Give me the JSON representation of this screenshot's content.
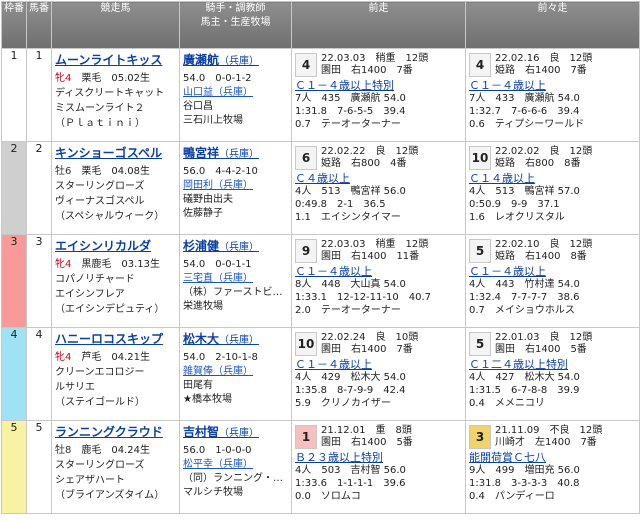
{
  "header": {
    "waku": "枠番",
    "umaban": "馬番",
    "horse": "競走馬",
    "jockey_l1": "騎手・調教師",
    "jockey_l2": "馬主・生産牧場",
    "prev1": "前走",
    "prev2": "前々走"
  },
  "colors": {
    "waku1": "#ffffff",
    "waku2": "#cfcfcf",
    "waku3": "#f99a9a",
    "waku4": "#9fe2f4",
    "waku5": "#f7f3a3",
    "link": "#0b3fa8",
    "filly": "#d6001c"
  },
  "rows": [
    {
      "waku": "1",
      "umaban": "1",
      "horse": {
        "name": "ムーンライトキッス",
        "sex": "牝4",
        "filly": true,
        "coat": "栗毛",
        "birth": "05.02生",
        "sire": "ディスクリートキャット",
        "dam": "ミスムーンライト２",
        "damsire": "（Ｐｌａｔｉｎｉ）"
      },
      "jockey": {
        "name": "廣瀬航",
        "loc": "（兵庫）",
        "wline": "54.0　0-0-1-2",
        "trainer": "山口益（兵庫）",
        "owner": "谷口昌",
        "breeder": "三石川上牧場"
      },
      "prev1": {
        "rank": "4",
        "l1": "22.03.03　稍重　12頭",
        "l2": "園田　右1400　7番",
        "title": "Ｃ１－４歳以上特別",
        "l3": "7人　435　廣瀬航 54.0",
        "l4": "1:31.8　7-6-5-5　39.4",
        "l5": "0.7　テーオーターナー"
      },
      "prev2": {
        "rank": "4",
        "l1": "22.02.16　良　12頭",
        "l2": "姫路　右1400　7番",
        "title": "Ｃ１－４歳以上",
        "l3": "7人　433　廣瀬航 54.0",
        "l4": "1:32.7　7-6-6-6　39.4",
        "l5": "0.6　ティプシーワールド"
      }
    },
    {
      "waku": "2",
      "umaban": "2",
      "horse": {
        "name": "キンショーゴスペル",
        "sex": "牡6",
        "filly": false,
        "coat": "栗毛",
        "birth": "04.08生",
        "sire": "スターリングローズ",
        "dam": "ヴィーナスゴスペル",
        "damsire": "（スペシャルウィーク）"
      },
      "jockey": {
        "name": "鴨宮祥",
        "loc": "（兵庫）",
        "wline": "56.0　4-4-2-10",
        "trainer": "岡田利（兵庫）",
        "owner": "礒野由出夫",
        "breeder": "佐藤静子"
      },
      "prev1": {
        "rank": "6",
        "l1": "22.02.22　良　12頭",
        "l2": "姫路　右800　4番",
        "title": "Ｃ４歳以上",
        "l3": "4人　513　鴨宮祥 56.0",
        "l4": "0:49.8　2-1　36.5",
        "l5": "1.1　エイシンタイマー"
      },
      "prev2": {
        "rank": "10",
        "l1": "22.02.02　良　12頭",
        "l2": "姫路　右800　8番",
        "title": "Ｃ１４歳以上",
        "l3": "4人　513　鴨宮祥 57.0",
        "l4": "0:50.9　9-9　37.1",
        "l5": "1.6　レオクリスタル"
      }
    },
    {
      "waku": "3",
      "umaban": "3",
      "horse": {
        "name": "エイシンリカルダ",
        "sex": "牝4",
        "filly": true,
        "coat": "黒鹿毛",
        "birth": "03.13生",
        "sire": "コパノリチャード",
        "dam": "エイシンフレア",
        "damsire": "（エイシンデピュティ）"
      },
      "jockey": {
        "name": "杉浦健",
        "loc": "（兵庫）",
        "wline": "54.0　0-0-1-1",
        "trainer": "三宅直（兵庫）",
        "owner": "（株）ファーストビ…",
        "breeder": "栄進牧場"
      },
      "prev1": {
        "rank": "9",
        "l1": "22.03.03　稍重　12頭",
        "l2": "園田　右1400　11番",
        "title": "Ｃ１－４歳以上",
        "l3": "8人　448　大山真 54.0",
        "l4": "1:33.1　12-12-11-10　40.7",
        "l5": "2.0　テーオーターナー"
      },
      "prev2": {
        "rank": "5",
        "l1": "22.02.10　良　12頭",
        "l2": "姫路　右1400　8番",
        "title": "Ｃ１－４歳以上",
        "l3": "4人　443　竹村達 54.0",
        "l4": "1:32.4　7-7-7-7　38.6",
        "l5": "0.7　メイショウホルス"
      }
    },
    {
      "waku": "4",
      "umaban": "4",
      "horse": {
        "name": "ハニーロコスキップ",
        "sex": "牝4",
        "filly": true,
        "coat": "芦毛",
        "birth": "04.21生",
        "sire": "クリーンエコロジー",
        "dam": "ルサリエ",
        "damsire": "（ステイゴールド）"
      },
      "jockey": {
        "name": "松木大",
        "loc": "（兵庫）",
        "wline": "54.0　2-10-1-8",
        "trainer": "雑賀俸（兵庫）",
        "owner": "田尾有",
        "breeder": "★橋本牧場"
      },
      "prev1": {
        "rank": "10",
        "l1": "22.02.24　良　10頭",
        "l2": "園田　右1400　7番",
        "title": "Ｃ１－４歳以上",
        "l3": "4人　429　松木大 54.0",
        "l4": "1:35.8　8-7-9-9　42.4",
        "l5": "5.9　クリノカイザー"
      },
      "prev2": {
        "rank": "5",
        "l1": "22.01.03　良　12頭",
        "l2": "園田　右1400　5番",
        "title": "Ｃ１二４歳以上特別",
        "l3": "4人　427　松木大 54.0",
        "l4": "1:31.5　6-7-8-8　39.9",
        "l5": "0.4　メメニコリ"
      }
    },
    {
      "waku": "5",
      "umaban": "5",
      "horse": {
        "name": "ランニングクラウド",
        "sex": "牡8",
        "filly": false,
        "coat": "鹿毛",
        "birth": "04.24生",
        "sire": "スターリングローズ",
        "dam": "シェアザハート",
        "damsire": "（ブライアンズタイム）"
      },
      "jockey": {
        "name": "吉村智",
        "loc": "（兵庫）",
        "wline": "56.0　1-0-0-0",
        "trainer": "松平幸（兵庫）",
        "owner": "（同）ランニング・…",
        "breeder": "マルシチ牧場"
      },
      "prev1": {
        "rank": "1",
        "l1": "21.12.01　重　8頭",
        "l2": "園田　右1400　5番",
        "title": "Ｂ２３歳以上特別",
        "l3": "4人　503　吉村智 56.0",
        "l4": "1:33.6　1-1-1-1　39.6",
        "l5": "0.0　ソロムコ"
      },
      "prev2": {
        "rank": "3",
        "l1": "21.11.09　不良　12頭",
        "l2": "川崎才　左1400　7番",
        "title": "能開荷賞Ｃ七八",
        "l3": "9人　499　増田充 56.0",
        "l4": "1:31.8　3-3-3-3　40.8",
        "l5": "0.4　パンディーロ"
      }
    }
  ]
}
